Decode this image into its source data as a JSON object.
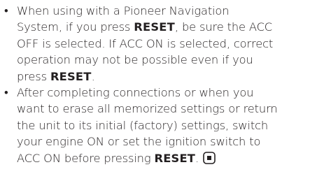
{
  "bullet_char": "•",
  "key_label": "RESET",
  "notes": [
    {
      "l1": "When using with a Pioneer Navigation",
      "l2": "System, if you press ",
      "l2_key": "RESET",
      "l2_after": ", be sure the ACC",
      "l3": "OFF is selected. If ACC ON is selected, correct",
      "l4": "operation may not be possible even if you",
      "l5": "press ",
      "l5_key": "RESET",
      "l5_after": "."
    },
    {
      "l1": "After completing connections or when you",
      "l2": "want to erase all memorized settings or return",
      "l3": "the unit to its initial (factory) settings, switch",
      "l4": "your engine ON or set the ignition switch to",
      "l5": "ACC ON before pressing ",
      "l5_key": "RESET",
      "l5_after": "."
    }
  ],
  "end_icon": "section-end-icon"
}
